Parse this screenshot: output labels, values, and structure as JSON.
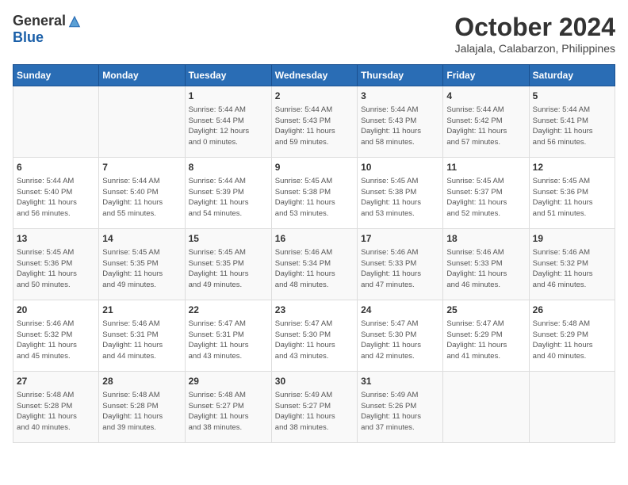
{
  "header": {
    "logo_general": "General",
    "logo_blue": "Blue",
    "month": "October 2024",
    "location": "Jalajala, Calabarzon, Philippines"
  },
  "days_of_week": [
    "Sunday",
    "Monday",
    "Tuesday",
    "Wednesday",
    "Thursday",
    "Friday",
    "Saturday"
  ],
  "weeks": [
    [
      {
        "day": "",
        "details": ""
      },
      {
        "day": "",
        "details": ""
      },
      {
        "day": "1",
        "details": "Sunrise: 5:44 AM\nSunset: 5:44 PM\nDaylight: 12 hours\nand 0 minutes."
      },
      {
        "day": "2",
        "details": "Sunrise: 5:44 AM\nSunset: 5:43 PM\nDaylight: 11 hours\nand 59 minutes."
      },
      {
        "day": "3",
        "details": "Sunrise: 5:44 AM\nSunset: 5:43 PM\nDaylight: 11 hours\nand 58 minutes."
      },
      {
        "day": "4",
        "details": "Sunrise: 5:44 AM\nSunset: 5:42 PM\nDaylight: 11 hours\nand 57 minutes."
      },
      {
        "day": "5",
        "details": "Sunrise: 5:44 AM\nSunset: 5:41 PM\nDaylight: 11 hours\nand 56 minutes."
      }
    ],
    [
      {
        "day": "6",
        "details": "Sunrise: 5:44 AM\nSunset: 5:40 PM\nDaylight: 11 hours\nand 56 minutes."
      },
      {
        "day": "7",
        "details": "Sunrise: 5:44 AM\nSunset: 5:40 PM\nDaylight: 11 hours\nand 55 minutes."
      },
      {
        "day": "8",
        "details": "Sunrise: 5:44 AM\nSunset: 5:39 PM\nDaylight: 11 hours\nand 54 minutes."
      },
      {
        "day": "9",
        "details": "Sunrise: 5:45 AM\nSunset: 5:38 PM\nDaylight: 11 hours\nand 53 minutes."
      },
      {
        "day": "10",
        "details": "Sunrise: 5:45 AM\nSunset: 5:38 PM\nDaylight: 11 hours\nand 53 minutes."
      },
      {
        "day": "11",
        "details": "Sunrise: 5:45 AM\nSunset: 5:37 PM\nDaylight: 11 hours\nand 52 minutes."
      },
      {
        "day": "12",
        "details": "Sunrise: 5:45 AM\nSunset: 5:36 PM\nDaylight: 11 hours\nand 51 minutes."
      }
    ],
    [
      {
        "day": "13",
        "details": "Sunrise: 5:45 AM\nSunset: 5:36 PM\nDaylight: 11 hours\nand 50 minutes."
      },
      {
        "day": "14",
        "details": "Sunrise: 5:45 AM\nSunset: 5:35 PM\nDaylight: 11 hours\nand 49 minutes."
      },
      {
        "day": "15",
        "details": "Sunrise: 5:45 AM\nSunset: 5:35 PM\nDaylight: 11 hours\nand 49 minutes."
      },
      {
        "day": "16",
        "details": "Sunrise: 5:46 AM\nSunset: 5:34 PM\nDaylight: 11 hours\nand 48 minutes."
      },
      {
        "day": "17",
        "details": "Sunrise: 5:46 AM\nSunset: 5:33 PM\nDaylight: 11 hours\nand 47 minutes."
      },
      {
        "day": "18",
        "details": "Sunrise: 5:46 AM\nSunset: 5:33 PM\nDaylight: 11 hours\nand 46 minutes."
      },
      {
        "day": "19",
        "details": "Sunrise: 5:46 AM\nSunset: 5:32 PM\nDaylight: 11 hours\nand 46 minutes."
      }
    ],
    [
      {
        "day": "20",
        "details": "Sunrise: 5:46 AM\nSunset: 5:32 PM\nDaylight: 11 hours\nand 45 minutes."
      },
      {
        "day": "21",
        "details": "Sunrise: 5:46 AM\nSunset: 5:31 PM\nDaylight: 11 hours\nand 44 minutes."
      },
      {
        "day": "22",
        "details": "Sunrise: 5:47 AM\nSunset: 5:31 PM\nDaylight: 11 hours\nand 43 minutes."
      },
      {
        "day": "23",
        "details": "Sunrise: 5:47 AM\nSunset: 5:30 PM\nDaylight: 11 hours\nand 43 minutes."
      },
      {
        "day": "24",
        "details": "Sunrise: 5:47 AM\nSunset: 5:30 PM\nDaylight: 11 hours\nand 42 minutes."
      },
      {
        "day": "25",
        "details": "Sunrise: 5:47 AM\nSunset: 5:29 PM\nDaylight: 11 hours\nand 41 minutes."
      },
      {
        "day": "26",
        "details": "Sunrise: 5:48 AM\nSunset: 5:29 PM\nDaylight: 11 hours\nand 40 minutes."
      }
    ],
    [
      {
        "day": "27",
        "details": "Sunrise: 5:48 AM\nSunset: 5:28 PM\nDaylight: 11 hours\nand 40 minutes."
      },
      {
        "day": "28",
        "details": "Sunrise: 5:48 AM\nSunset: 5:28 PM\nDaylight: 11 hours\nand 39 minutes."
      },
      {
        "day": "29",
        "details": "Sunrise: 5:48 AM\nSunset: 5:27 PM\nDaylight: 11 hours\nand 38 minutes."
      },
      {
        "day": "30",
        "details": "Sunrise: 5:49 AM\nSunset: 5:27 PM\nDaylight: 11 hours\nand 38 minutes."
      },
      {
        "day": "31",
        "details": "Sunrise: 5:49 AM\nSunset: 5:26 PM\nDaylight: 11 hours\nand 37 minutes."
      },
      {
        "day": "",
        "details": ""
      },
      {
        "day": "",
        "details": ""
      }
    ]
  ]
}
